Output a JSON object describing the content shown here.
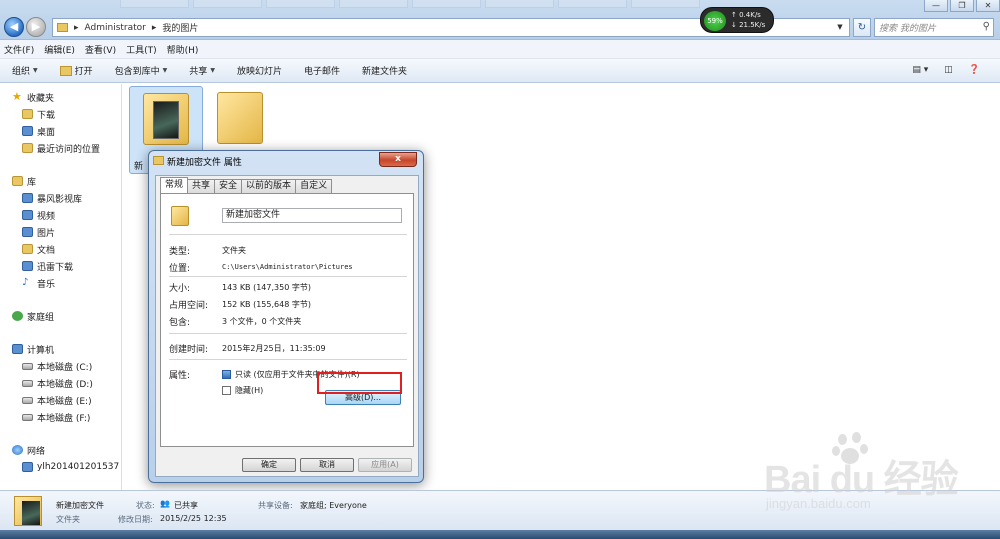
{
  "window": {
    "breadcrumb": [
      "Administrator",
      "我的图片"
    ],
    "search_placeholder": "搜索 我的图片",
    "controls": [
      "—",
      "❐",
      "✕"
    ]
  },
  "net_widget": {
    "percent": "59%",
    "up": "0.4K/s",
    "down": "21.5K/s"
  },
  "menubar": [
    "文件(F)",
    "编辑(E)",
    "查看(V)",
    "工具(T)",
    "帮助(H)"
  ],
  "toolbar": {
    "organize": "组织",
    "open": "打开",
    "include_library": "包含到库中",
    "share": "共享",
    "slideshow": "放映幻灯片",
    "email": "电子邮件",
    "new_folder": "新建文件夹"
  },
  "nav": {
    "favorites": {
      "label": "收藏夹",
      "items": [
        "下载",
        "桌面",
        "最近访问的位置"
      ]
    },
    "libraries": {
      "label": "库",
      "items": [
        "暴风影视库",
        "视频",
        "图片",
        "文档",
        "迅雷下载",
        "音乐"
      ]
    },
    "homegroup": "家庭组",
    "computer": {
      "label": "计算机",
      "items": [
        "本地磁盘 (C:)",
        "本地磁盘 (D:)",
        "本地磁盘 (E:)",
        "本地磁盘 (F:)"
      ]
    },
    "network": {
      "label": "网络",
      "items": [
        "ylh201401201537"
      ]
    }
  },
  "content": {
    "file1_label": "新"
  },
  "dialog": {
    "title": "新建加密文件 属性",
    "close": "x",
    "tabs": [
      "常规",
      "共享",
      "安全",
      "以前的版本",
      "自定义"
    ],
    "folder_name": "新建加密文件",
    "type_label": "类型:",
    "type_value": "文件夹",
    "location_label": "位置:",
    "location_value": "C:\\Users\\Administrator\\Pictures",
    "size_label": "大小:",
    "size_value": "143 KB (147,350 字节)",
    "disk_size_label": "占用空间:",
    "disk_size_value": "152 KB (155,648 字节)",
    "contains_label": "包含:",
    "contains_value": "3 个文件，0 个文件夹",
    "created_label": "创建时间:",
    "created_value": "2015年2月25日，11:35:09",
    "attributes_label": "属性:",
    "readonly_label": "只读 (仅应用于文件夹中的文件)(R)",
    "hidden_label": "隐藏(H)",
    "advanced_button": "高级(D)...",
    "ok": "确定",
    "cancel": "取消",
    "apply": "应用(A)"
  },
  "details": {
    "name": "新建加密文件",
    "type": "文件夹",
    "state_key": "状态:",
    "state_value": "已共享",
    "modified_key": "修改日期:",
    "modified_value": "2015/2/25 12:35",
    "share_key": "共享设备:",
    "share_value": "家庭组; Everyone"
  },
  "watermark": {
    "text": "Bai  du 经验",
    "url": "jingyan.baidu.com"
  },
  "colors": {
    "highlight": "#e02020",
    "accent": "#2a6fc6"
  }
}
